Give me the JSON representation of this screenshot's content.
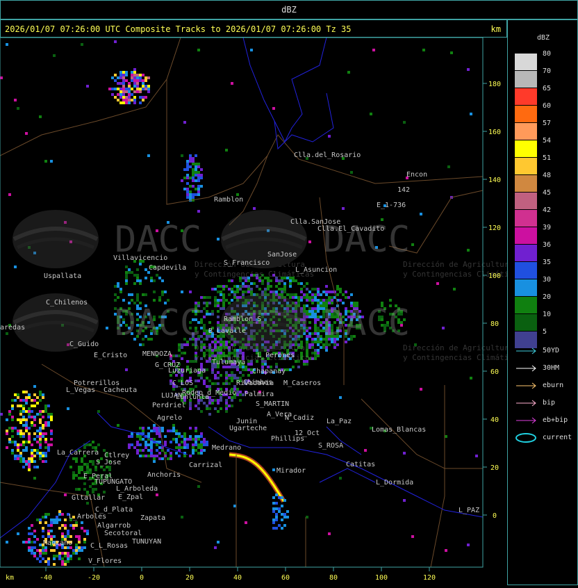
{
  "header": {
    "title": "dBZ"
  },
  "subtitle": {
    "text": "2026/01/07 07:26:00 UTC Composite Tracks to 2026/01/07 07:26:00 Tz 35",
    "km": "km"
  },
  "axes": {
    "x_label": "km",
    "x_ticks": [
      "-40",
      "-20",
      "0",
      "20",
      "40",
      "60",
      "80",
      "100",
      "120"
    ],
    "y_ticks": [
      "180",
      "160",
      "140",
      "120",
      "100",
      "80",
      "60",
      "40",
      "20",
      "0"
    ]
  },
  "watermark": {
    "logo": "DACC",
    "line1": "Dirección de Agricultura",
    "line2": "y Contingencias Climáticas"
  },
  "places": [
    "Clla.del_Rosario",
    "Encon",
    "142",
    "E_1-736",
    "Ramblon",
    "Clla.SanJose",
    "Clla.El_Cavadito",
    "Villavicencio",
    "Capdevila",
    "S_Francisco",
    "SanJose",
    "L_Asuncion",
    "Uspallata",
    "C_Chilenos",
    "aredas",
    "C_Guido",
    "E_Cristo",
    "MENDOZA",
    "G_CRUZ",
    "Luzuriaga",
    "C_LOS",
    "Rodeo_d_Medio",
    "Potrerillos",
    "Cacheuta",
    "L_Vegas",
    "LUJAN",
    "Lunlunta",
    "Perdriel",
    "Agrelo",
    "Tulumaya",
    "Chapanay",
    "Chimbas",
    "M_Caseros",
    "L_Perones",
    "Rivadavia",
    "S_MARTIN",
    "Junin",
    "A_Vera",
    "N_Cadiz",
    "Ugarteche",
    "12_Oct",
    "S_ROSA",
    "Lomas_Blancas",
    "La_Paz",
    "Catitas",
    "L_Dormida",
    "L_PAZ",
    "La_Carrera",
    "Ctlrey",
    "S_Jose",
    "E_Peral",
    "TUPUNGATO",
    "Anchoris",
    "Carrizal",
    "Mirador",
    "Gltallar",
    "E_Zpal",
    "L_Arboleda",
    "C_d_Plata",
    "Zapata",
    "L_Arboles",
    "Algarrob",
    "Secotoral",
    "TUNUYAN",
    "Manzano",
    "C_L_Rosas",
    "V_Flores",
    "Medrano",
    "Phillips",
    "Ramblon_S",
    "Palmira",
    "B_Lavalle"
  ],
  "legend": {
    "title": "dBZ",
    "scale": [
      {
        "label": "80",
        "color": "#d8d8d8"
      },
      {
        "label": "70",
        "color": "#b8b8b8"
      },
      {
        "label": "65",
        "color": "#ff3a2a"
      },
      {
        "label": "60",
        "color": "#ff6a10"
      },
      {
        "label": "57",
        "color": "#ff9a5a"
      },
      {
        "label": "54",
        "color": "#ffff00"
      },
      {
        "label": "51",
        "color": "#ffc830"
      },
      {
        "label": "48",
        "color": "#d08840"
      },
      {
        "label": "45",
        "color": "#c06080"
      },
      {
        "label": "42",
        "color": "#d03090"
      },
      {
        "label": "39",
        "color": "#cc10a0"
      },
      {
        "label": "36",
        "color": "#7020d0"
      },
      {
        "label": "35",
        "color": "#2050e0"
      },
      {
        "label": "30",
        "color": "#1890e0"
      },
      {
        "label": "20",
        "color": "#108010"
      },
      {
        "label": "10",
        "color": "#0a6010"
      },
      {
        "label": "5",
        "color": "#404090"
      }
    ],
    "tracks": [
      {
        "label": "50YD",
        "color": "#40d0e0"
      },
      {
        "label": "30HM",
        "color": "#ffffff"
      },
      {
        "label": "eburn",
        "color": "#ffc870"
      },
      {
        "label": "bip",
        "color": "#ffb0d0"
      },
      {
        "label": "eb+bip",
        "color": "#e040e0"
      },
      {
        "label": "current",
        "color": "#20d0e0"
      }
    ]
  }
}
